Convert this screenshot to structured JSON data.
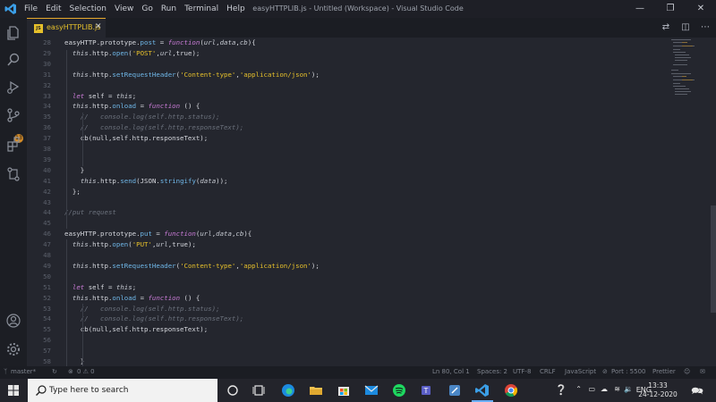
{
  "app": {
    "menu": [
      "File",
      "Edit",
      "Selection",
      "View",
      "Go",
      "Run",
      "Terminal",
      "Help"
    ],
    "window_title": "easyHTTPLIB.js - Untitled (Workspace) - Visual Studio Code"
  },
  "activity": {
    "badge": "13"
  },
  "tab": {
    "name": "easyHTTPLIB.js",
    "icon_text": "JS"
  },
  "editor": {
    "lines": [
      {
        "n": "28",
        "t": "easyHTTP.prototype.post = function(url,data,cb){"
      },
      {
        "n": "29",
        "t": "  this.http.open('POST',url,true);"
      },
      {
        "n": "30",
        "t": ""
      },
      {
        "n": "31",
        "t": "  this.http.setRequestHeader('Content-type','application/json');"
      },
      {
        "n": "32",
        "t": ""
      },
      {
        "n": "33",
        "t": "  let self = this;"
      },
      {
        "n": "34",
        "t": "  this.http.onload = function () {"
      },
      {
        "n": "35",
        "t": "    //   console.log(self.http.status);"
      },
      {
        "n": "36",
        "t": "    //   console.log(self.http.responseText);"
      },
      {
        "n": "37",
        "t": "    cb(null,self.http.responseText);"
      },
      {
        "n": "38",
        "t": ""
      },
      {
        "n": "39",
        "t": ""
      },
      {
        "n": "40",
        "t": "    }"
      },
      {
        "n": "41",
        "t": "    this.http.send(JSON.stringify(data));"
      },
      {
        "n": "42",
        "t": "  };"
      },
      {
        "n": "43",
        "t": ""
      },
      {
        "n": "44",
        "t": "//put request"
      },
      {
        "n": "45",
        "t": ""
      },
      {
        "n": "46",
        "t": "easyHTTP.prototype.put = function(url,data,cb){"
      },
      {
        "n": "47",
        "t": "  this.http.open('PUT',url,true);"
      },
      {
        "n": "48",
        "t": ""
      },
      {
        "n": "49",
        "t": "  this.http.setRequestHeader('Content-type','application/json');"
      },
      {
        "n": "50",
        "t": ""
      },
      {
        "n": "51",
        "t": "  let self = this;"
      },
      {
        "n": "52",
        "t": "  this.http.onload = function () {"
      },
      {
        "n": "53",
        "t": "    //   console.log(self.http.status);"
      },
      {
        "n": "54",
        "t": "    //   console.log(self.http.responseText);"
      },
      {
        "n": "55",
        "t": "    cb(null,self.http.responseText);"
      },
      {
        "n": "56",
        "t": ""
      },
      {
        "n": "57",
        "t": ""
      },
      {
        "n": "58",
        "t": "    }"
      }
    ]
  },
  "status": {
    "branch": "master*",
    "problems": "0 ⚠ 0",
    "position": "Ln 80, Col 1",
    "spaces": "Spaces: 2",
    "encoding": "UTF-8",
    "eol": "CRLF",
    "language": "JavaScript",
    "port": "Port : 5500",
    "formatter": "Prettier"
  },
  "taskbar": {
    "search_placeholder": "Type here to search",
    "lang": "ENG",
    "time": "13:33",
    "date": "24-12-2020"
  },
  "colors": {
    "accent": "#e6a82c",
    "keyword": "#c97bd6",
    "string": "#e6c02b",
    "comment": "#6b717c"
  }
}
